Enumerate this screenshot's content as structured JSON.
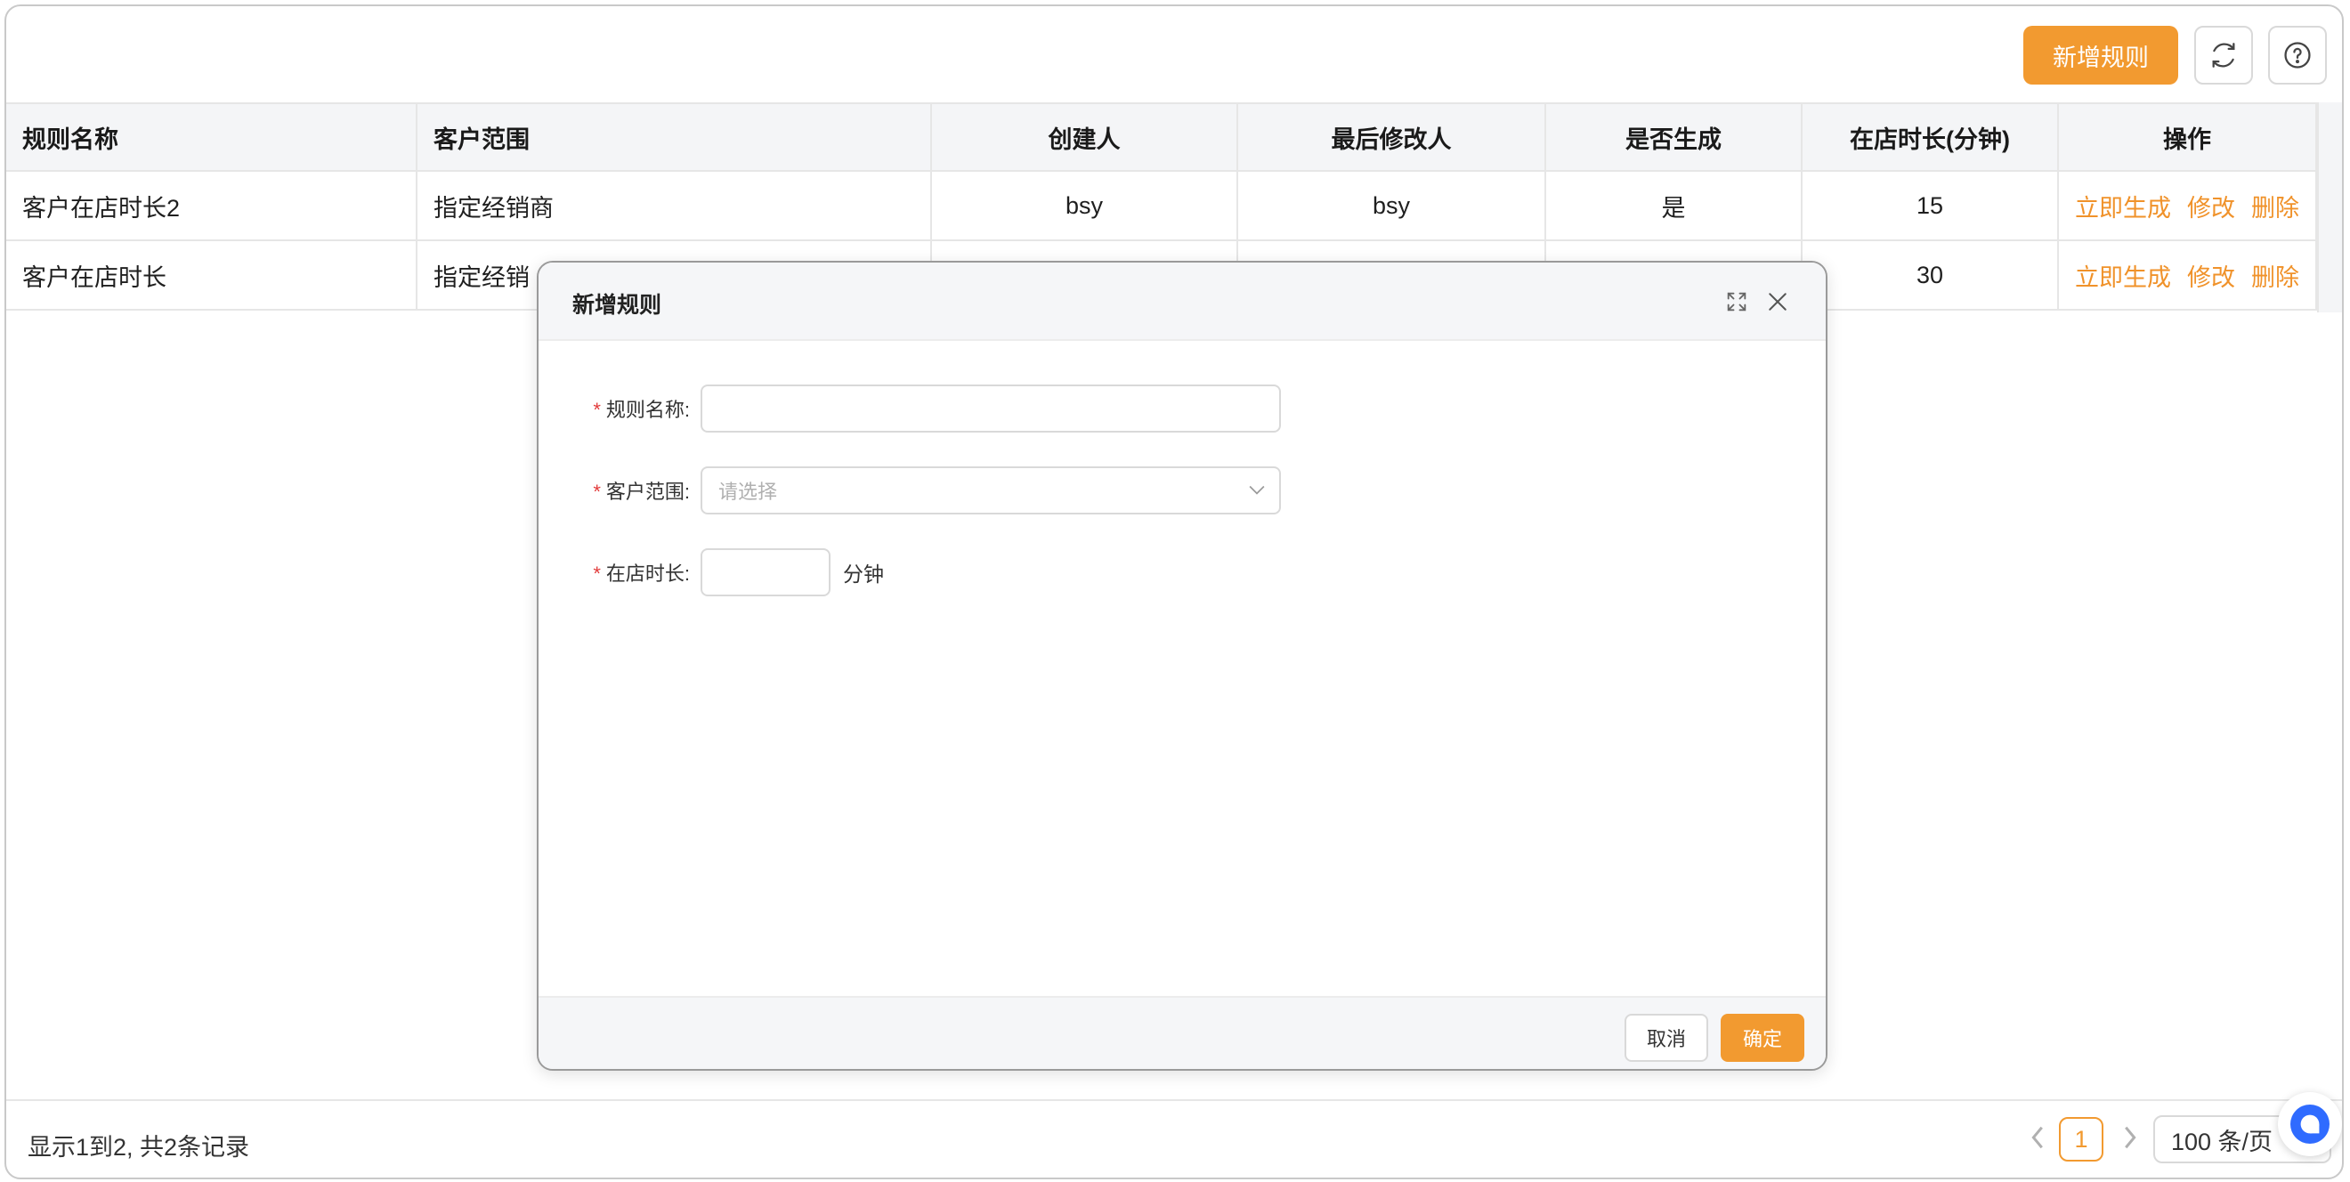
{
  "toolbar": {
    "add_rule_label": "新增规则",
    "refresh_icon": "refresh-icon",
    "help_icon": "question-circle-icon"
  },
  "table": {
    "headers": [
      "规则名称",
      "客户范围",
      "创建人",
      "最后修改人",
      "是否生成",
      "在店时长(分钟)",
      "操作"
    ],
    "rows": [
      {
        "name": "客户在店时长2",
        "scope": "指定经销商",
        "creator": "bsy",
        "modifier": "bsy",
        "generated": "是",
        "duration": "15"
      },
      {
        "name": "客户在店时长",
        "scope": "指定经销",
        "creator": "",
        "modifier": "",
        "generated": "",
        "duration": "30"
      }
    ],
    "actions": {
      "generate": "立即生成",
      "edit": "修改",
      "delete": "删除"
    }
  },
  "footer": {
    "record_info": "显示1到2, 共2条记录",
    "current_page": "1",
    "page_size": "100 条/页",
    "prev_icon": "chevron-left-icon",
    "next_icon": "chevron-right-icon"
  },
  "modal": {
    "title": "新增规则",
    "expand_icon": "expand-icon",
    "close_icon": "close-icon",
    "fields": {
      "rule_name_label": "规则名称:",
      "scope_label": "客户范围:",
      "scope_placeholder": "请选择",
      "duration_label": "在店时长:",
      "duration_unit": "分钟"
    },
    "cancel_label": "取消",
    "ok_label": "确定"
  },
  "colors": {
    "accent": "#f29a30",
    "required": "#e23b3b",
    "action_link": "#f0922a"
  }
}
